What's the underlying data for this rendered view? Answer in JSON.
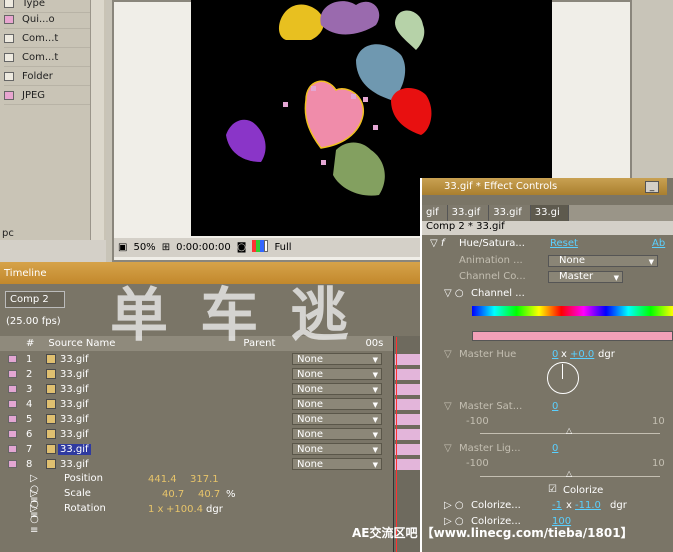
{
  "project": {
    "items": [
      {
        "label": "Type",
        "icon": "type-icon"
      },
      {
        "label": "Qui...o",
        "icon": "pink-item-icon"
      },
      {
        "label": "Com...t",
        "icon": "comp-icon"
      },
      {
        "label": "Com...t",
        "icon": "comp-icon"
      },
      {
        "label": "Folder",
        "icon": "folder-icon"
      },
      {
        "label": "JPEG",
        "icon": "pink-item-icon"
      }
    ],
    "bottom_label": "pc"
  },
  "viewer": {
    "zoom": "50%",
    "timecode": "0:00:00:00",
    "resolution": "Full"
  },
  "timeline": {
    "title": "Timeline",
    "comp_tab": "Comp 2",
    "fps": "(25.00 fps)",
    "col_num": "#",
    "col_source": "Source Name",
    "col_parent": "Parent",
    "col_time": "00s",
    "layers": [
      {
        "num": "1",
        "name": "33.gif",
        "parent": "None"
      },
      {
        "num": "2",
        "name": "33.gif",
        "parent": "None"
      },
      {
        "num": "3",
        "name": "33.gif",
        "parent": "None"
      },
      {
        "num": "4",
        "name": "33.gif",
        "parent": "None"
      },
      {
        "num": "5",
        "name": "33.gif",
        "parent": "None"
      },
      {
        "num": "6",
        "name": "33.gif",
        "parent": "None"
      },
      {
        "num": "7",
        "name": "33.gif",
        "parent": "None"
      },
      {
        "num": "8",
        "name": "33.gif",
        "parent": "None"
      }
    ],
    "props": [
      {
        "name": "Position",
        "v1": "441.4",
        "v2": "317.1",
        "unit": ""
      },
      {
        "name": "Scale",
        "v1": "40.7",
        "v2": "40.7",
        "unit": "%"
      },
      {
        "name": "Rotation",
        "v1": "1 x",
        "v2": "+100.4",
        "unit": "dgr"
      }
    ]
  },
  "effects": {
    "title": "33.gif * Effect Controls",
    "tabs": [
      "gif",
      "33.gif",
      "33.gif",
      "33.gi"
    ],
    "comp_line": "Comp 2 * 33.gif",
    "effect_name": "Hue/Satura...",
    "reset": "Reset",
    "about": "Ab",
    "animation_label": "Animation ...",
    "animation_value": "None",
    "channel_ctrl_label": "Channel Co...",
    "channel_ctrl_value": "Master",
    "channel_range_label": "Channel ...",
    "master_hue_label": "Master Hue",
    "master_hue_rev": "0",
    "master_hue_deg": "+0.0",
    "master_hue_unit": "dgr",
    "master_sat_label": "Master Sat...",
    "master_sat_value": "0",
    "master_light_label": "Master Lig...",
    "master_light_value": "0",
    "min": "-100",
    "max": "10",
    "colorize_label": "Colorize",
    "colorize_hue_label": "Colorize...",
    "colorize_hue_rev": "-1",
    "colorize_hue_deg": "-11.0",
    "colorize_hue_unit": "dgr",
    "colorize_sat_label": "Colorize...",
    "colorize_sat_value": "100"
  },
  "watermark": {
    "big": "单 车 逃",
    "small": "AE交流区吧 【www.linecg.com/tieba/1801】"
  },
  "colors": {
    "heart_pink": "#f08caa",
    "heart_purple": "#8a35c8",
    "heart_red": "#e81010",
    "heart_blue": "#6f98b0",
    "heart_green": "#83a060",
    "heart_yellow": "#e8c020",
    "heart_lavender": "#9a6aae",
    "heart_mint": "#b6d2a8"
  }
}
